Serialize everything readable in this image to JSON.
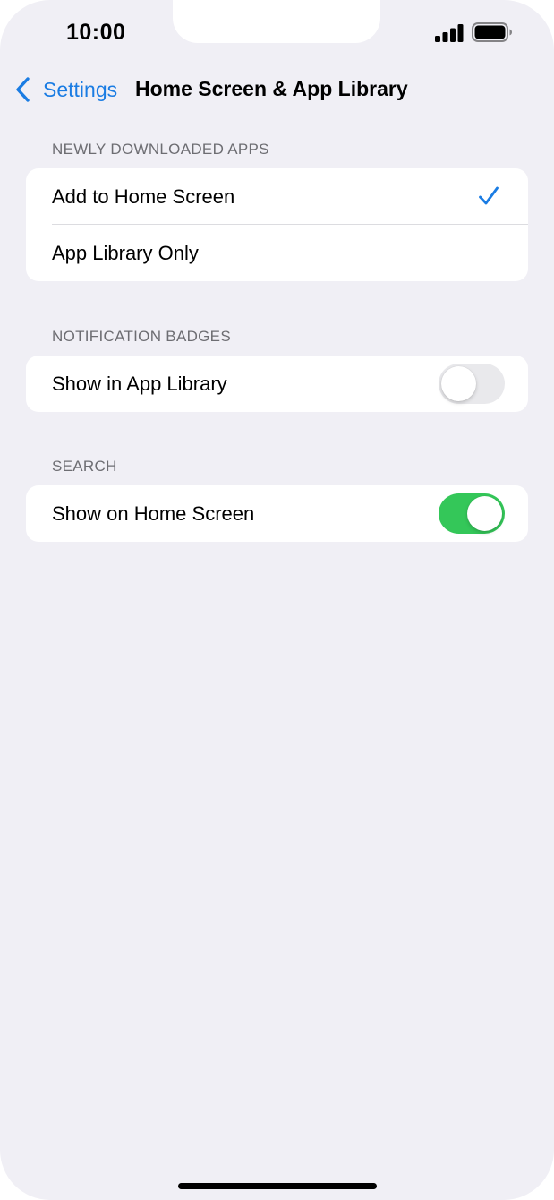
{
  "status_bar": {
    "time": "10:00",
    "signal_icon": "cellular-signal-icon",
    "battery_icon": "battery-full-icon"
  },
  "nav": {
    "back_label": "Settings",
    "back_icon": "chevron-left-icon",
    "title": "Home Screen & App Library",
    "accent_color": "#1a7ce3"
  },
  "sections": {
    "newly_downloaded": {
      "header": "NEWLY DOWNLOADED APPS",
      "options": [
        {
          "label": "Add to Home Screen",
          "selected": true
        },
        {
          "label": "App Library Only",
          "selected": false
        }
      ],
      "check_icon": "checkmark-icon"
    },
    "notification_badges": {
      "header": "NOTIFICATION BADGES",
      "row_label": "Show in App Library",
      "toggle_on": false
    },
    "search": {
      "header": "SEARCH",
      "row_label": "Show on Home Screen",
      "toggle_on": true,
      "toggle_on_color": "#34c759"
    }
  }
}
